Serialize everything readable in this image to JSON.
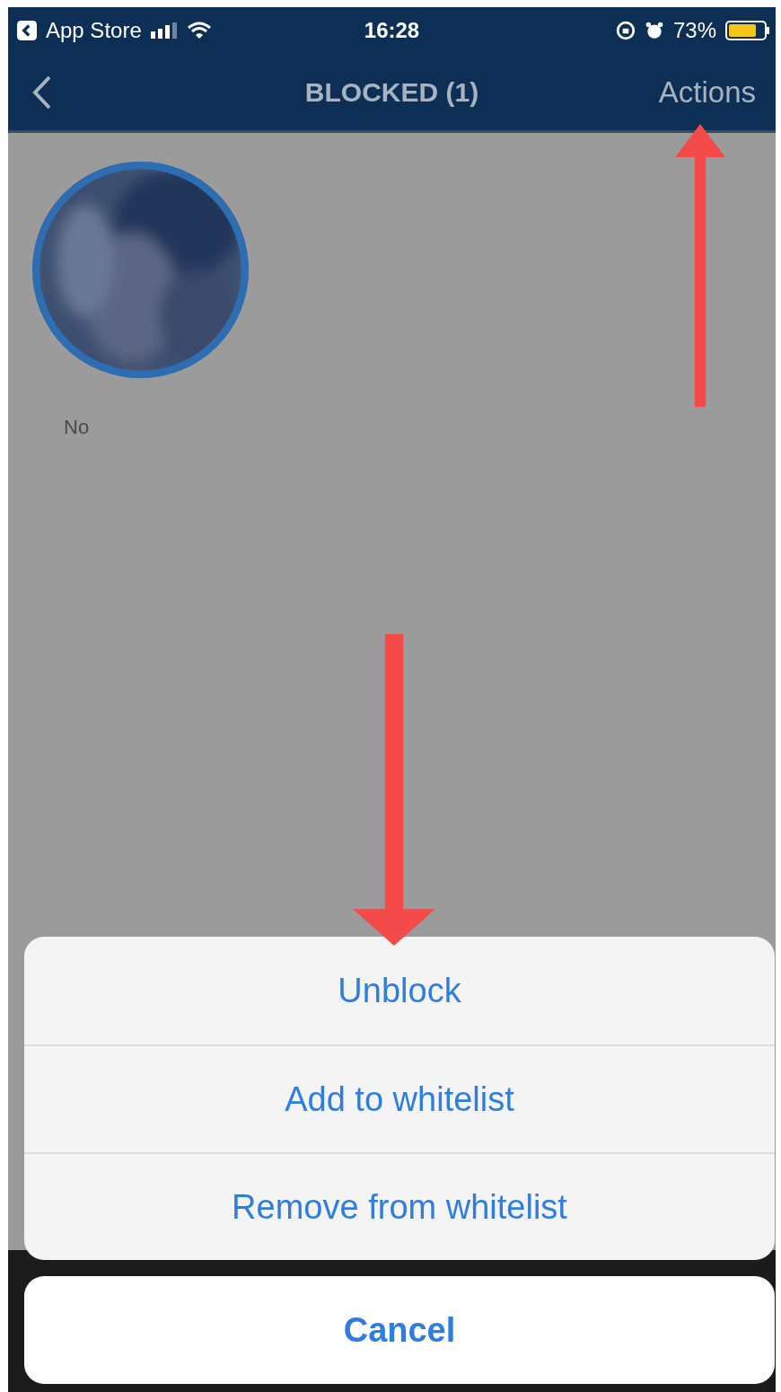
{
  "status_bar": {
    "back_app": "App Store",
    "time": "16:28",
    "battery": "73%"
  },
  "nav_bar": {
    "title": "BLOCKED (1)",
    "action": "Actions"
  },
  "users": [
    {
      "subtitle": "No"
    }
  ],
  "action_sheet": {
    "options": [
      "Unblock",
      "Add to whitelist",
      "Remove from whitelist"
    ],
    "cancel": "Cancel"
  },
  "annotations": [
    {
      "kind": "arrow-up"
    },
    {
      "kind": "arrow-down"
    }
  ]
}
